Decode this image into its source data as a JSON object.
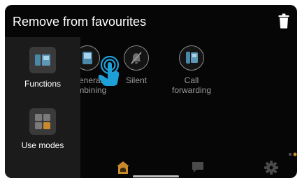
{
  "header": {
    "title": "Remove from favourites",
    "trash_icon": "trash-icon"
  },
  "side_panel": {
    "items": [
      {
        "label": "Functions",
        "icon": "functions-icon"
      },
      {
        "label": "Use modes",
        "icon": "use-modes-icon"
      }
    ]
  },
  "favourites": {
    "items": [
      {
        "label": "General\ncombining",
        "icon": "intercom-device-icon",
        "partially_hidden": true
      },
      {
        "label": "Silent",
        "icon": "bell-muted-icon"
      },
      {
        "label": "Call\nforwarding",
        "icon": "call-forwarding-icon"
      }
    ]
  },
  "bottom_nav": {
    "items": [
      {
        "icon": "home-icon",
        "active": true
      },
      {
        "icon": "chat-icon",
        "active": false
      },
      {
        "icon": "settings-gear-icon",
        "active": false
      }
    ]
  },
  "colors": {
    "accent": "#c98a2b",
    "background": "#060606",
    "panel": "#1b1b1b",
    "pointer": "#1e9fd8"
  }
}
